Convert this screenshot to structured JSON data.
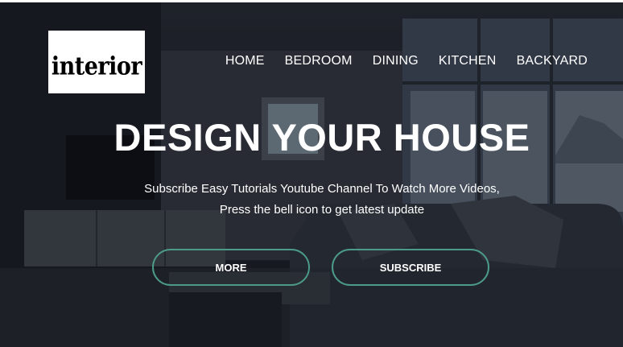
{
  "logo": {
    "text": "interior"
  },
  "nav": {
    "items": [
      {
        "label": "HOME"
      },
      {
        "label": "BEDROOM"
      },
      {
        "label": "DINING"
      },
      {
        "label": "KITCHEN"
      },
      {
        "label": "BACKYARD"
      }
    ]
  },
  "hero": {
    "headline": "DESIGN YOUR HOUSE",
    "subtitle_line1": "Subscribe Easy Tutorials Youtube Channel To Watch More Videos,",
    "subtitle_line2": "Press the bell icon to get latest update"
  },
  "buttons": {
    "more_label": "MORE",
    "subscribe_label": "SUBSCRIBE"
  },
  "colors": {
    "button_border": "#4c9a88",
    "text": "#ffffff",
    "overlay": "#0a0c12"
  }
}
